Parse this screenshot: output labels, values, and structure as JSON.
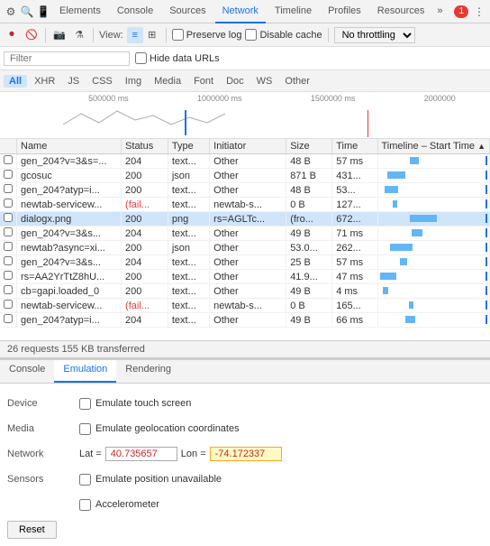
{
  "tabs": {
    "items": [
      {
        "label": "Elements",
        "active": false
      },
      {
        "label": "Console",
        "active": false
      },
      {
        "label": "Sources",
        "active": false
      },
      {
        "label": "Network",
        "active": true
      },
      {
        "label": "Timeline",
        "active": false
      },
      {
        "label": "Profiles",
        "active": false
      },
      {
        "label": "Resources",
        "active": false
      }
    ],
    "more": "»",
    "badge": "1"
  },
  "network_toolbar": {
    "view_label": "View:",
    "preserve_log": "Preserve log",
    "disable_cache": "Disable cache",
    "throttle": "No throttling"
  },
  "filter_bar": {
    "placeholder": "Filter",
    "hide_data": "Hide data URLs"
  },
  "type_filters": [
    "All",
    "XHR",
    "JS",
    "CSS",
    "Img",
    "Media",
    "Font",
    "Doc",
    "WS",
    "Other"
  ],
  "active_type": "All",
  "timeline": {
    "ticks": [
      "500000 ms",
      "1000000 ms",
      "1500000 ms",
      "2000000"
    ]
  },
  "table": {
    "columns": [
      "Name",
      "Status",
      "Type",
      "Initiator",
      "Size",
      "Time",
      "Timeline – Start Time"
    ],
    "rows": [
      {
        "name": "gen_204?v=3&s=...",
        "status": "204",
        "type": "text...",
        "initiator": "Other",
        "size": "48 B",
        "time": "57 ms",
        "waterfall": 10,
        "status_class": ""
      },
      {
        "name": "gcosuc",
        "status": "200",
        "type": "json",
        "initiator": "Other",
        "size": "871 B",
        "time": "431...",
        "waterfall": 20,
        "status_class": ""
      },
      {
        "name": "gen_204?atyp=i...",
        "status": "200",
        "type": "text...",
        "initiator": "Other",
        "size": "48 B",
        "time": "53...",
        "waterfall": 15,
        "status_class": ""
      },
      {
        "name": "newtab-servicew...",
        "status": "(fail...",
        "type": "text...",
        "initiator": "newtab-s...",
        "size": "0 B",
        "time": "127...",
        "waterfall": 5,
        "status_class": "status-fail"
      },
      {
        "name": "dialogx.png",
        "status": "200",
        "type": "png",
        "initiator": "rs=AGLTc...",
        "size": "(fro...",
        "time": "672...",
        "waterfall": 30,
        "status_class": ""
      },
      {
        "name": "gen_204?v=3&s...",
        "status": "204",
        "type": "text...",
        "initiator": "Other",
        "size": "49 B",
        "time": "71 ms",
        "waterfall": 12,
        "status_class": ""
      },
      {
        "name": "newtab?async=xi...",
        "status": "200",
        "type": "json",
        "initiator": "Other",
        "size": "53.0...",
        "time": "262...",
        "waterfall": 25,
        "status_class": ""
      },
      {
        "name": "gen_204?v=3&s...",
        "status": "204",
        "type": "text...",
        "initiator": "Other",
        "size": "25 B",
        "time": "57 ms",
        "waterfall": 8,
        "status_class": ""
      },
      {
        "name": "rs=AA2YrTtZ8hU...",
        "status": "200",
        "type": "text...",
        "initiator": "Other",
        "size": "41.9...",
        "time": "47 ms",
        "waterfall": 18,
        "status_class": ""
      },
      {
        "name": "cb=gapi.loaded_0",
        "status": "200",
        "type": "text...",
        "initiator": "Other",
        "size": "49 B",
        "time": "4 ms",
        "waterfall": 6,
        "status_class": ""
      },
      {
        "name": "newtab-servicew...",
        "status": "(fail...",
        "type": "text...",
        "initiator": "newtab-s...",
        "size": "0 B",
        "time": "165...",
        "waterfall": 5,
        "status_class": "status-fail"
      },
      {
        "name": "gen_204?atyp=i...",
        "status": "204",
        "type": "text...",
        "initiator": "Other",
        "size": "49 B",
        "time": "66 ms",
        "waterfall": 11,
        "status_class": ""
      }
    ]
  },
  "status_bar": {
    "text": "26 requests  155 KB transferred"
  },
  "bottom_tabs": [
    "Console",
    "Emulation",
    "Rendering"
  ],
  "active_bottom_tab": "Emulation",
  "emulation": {
    "device_label": "Device",
    "device_check": "Emulate touch screen",
    "media_label": "Media",
    "media_check": "Emulate geolocation coordinates",
    "network_label": "Network",
    "lat_label": "Lat =",
    "lat_value": "40.735657",
    "lon_label": "Lon =",
    "lon_value": "-74.172337",
    "unavailable_check": "Emulate position unavailable",
    "sensors_label": "Sensors",
    "accelerometer_check": "Accelerometer",
    "reset_label": "Reset"
  }
}
